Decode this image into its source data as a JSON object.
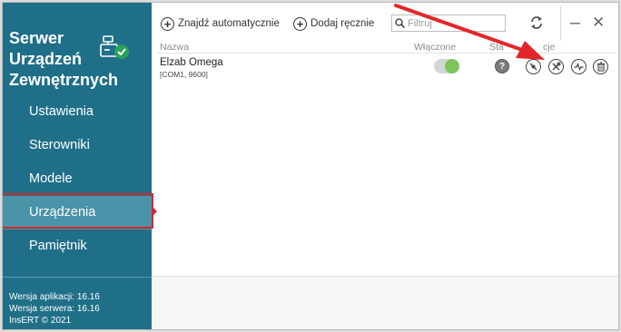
{
  "sidebar": {
    "title_lines": [
      "Serwer",
      "Urządzeń",
      "Zewnętrznych"
    ],
    "items": [
      {
        "label": "Ustawienia"
      },
      {
        "label": "Sterowniki"
      },
      {
        "label": "Modele"
      },
      {
        "label": "Urządzenia",
        "active": true
      },
      {
        "label": "Pamiętnik"
      }
    ],
    "version": {
      "app": "Wersja aplikacji: 16.16",
      "server": "Wersja serwera: 16.16",
      "copyright": "InsERT © 2021"
    }
  },
  "toolbar": {
    "find_auto_label": "Znajdź automatycznie",
    "add_manual_label": "Dodaj ręcznie",
    "filter_placeholder": "Filtruj",
    "minimize": "–",
    "close": "✕"
  },
  "table": {
    "columns": {
      "name": "Nazwa",
      "enabled": "Włączone",
      "status": "Sta",
      "actions": "cje"
    },
    "rows": [
      {
        "name": "Elzab Omega",
        "port": "[COM1, 9600]",
        "enabled": true,
        "status_icon": "?"
      }
    ]
  },
  "colors": {
    "sidebar_bg": "#1f6f88",
    "active_item_bg": "#4a93a8",
    "toggle_on": "#7dc45a",
    "highlight_red": "#d8262c",
    "logo_check": "#2aa05a"
  }
}
